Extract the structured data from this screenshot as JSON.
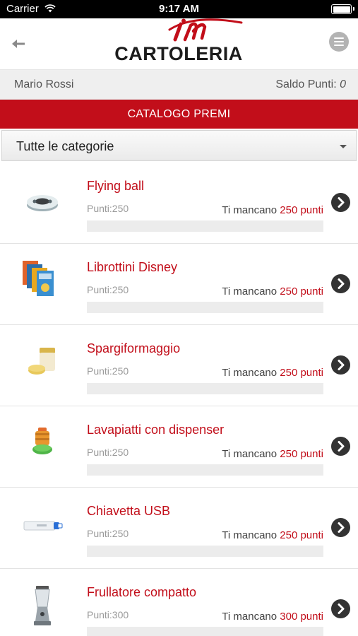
{
  "status_bar": {
    "carrier": "Carrier",
    "time": "9:17 AM"
  },
  "header": {
    "logo_script": "in",
    "logo_text": "CARTOLERIA",
    "brand_color": "#c20e1a",
    "back_icon": "back-arrow-icon",
    "menu_icon": "hamburger-menu-icon"
  },
  "user_bar": {
    "name": "Mario Rossi",
    "balance_label": "Saldo Punti:",
    "balance_value": "0"
  },
  "title_bar": {
    "label": "CATALOGO PREMI"
  },
  "category_filter": {
    "selected": "Tutte le categorie"
  },
  "products": [
    {
      "name": "Flying ball",
      "points_text": "Punti:250",
      "missing_prefix": "Ti mancano",
      "missing_value": "250 punti",
      "progress": 0,
      "icon": "flying-ball-thumbnail"
    },
    {
      "name": "Librottini Disney",
      "points_text": "Punti:250",
      "missing_prefix": "Ti mancano",
      "missing_value": "250 punti",
      "progress": 0,
      "icon": "disney-books-thumbnail"
    },
    {
      "name": "Spargiformaggio",
      "points_text": "Punti:250",
      "missing_prefix": "Ti mancano",
      "missing_value": "250 punti",
      "progress": 0,
      "icon": "cheese-shaker-thumbnail"
    },
    {
      "name": "Lavapiatti con dispenser",
      "points_text": "Punti:250",
      "missing_prefix": "Ti mancano",
      "missing_value": "250 punti",
      "progress": 0,
      "icon": "dish-brush-thumbnail"
    },
    {
      "name": "Chiavetta USB",
      "points_text": "Punti:250",
      "missing_prefix": "Ti mancano",
      "missing_value": "250 punti",
      "progress": 0,
      "icon": "usb-stick-thumbnail"
    },
    {
      "name": "Frullatore compatto",
      "points_text": "Punti:300",
      "missing_prefix": "Ti mancano",
      "missing_value": "300 punti",
      "progress": 0,
      "icon": "blender-thumbnail"
    }
  ]
}
